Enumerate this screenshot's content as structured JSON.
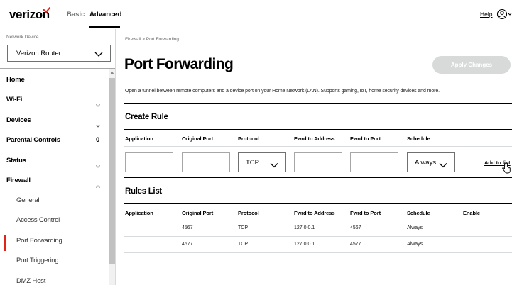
{
  "header": {
    "logo_text": "verizon",
    "tabs": [
      {
        "label": "Basic"
      },
      {
        "label": "Advanced"
      }
    ],
    "help_label": "Help",
    "accent_color": "#e2231a"
  },
  "sidebar": {
    "network_device_label": "Network Device",
    "network_device_value": "Verizon Router",
    "items": [
      {
        "label": "Home"
      },
      {
        "label": "Wi-Fi"
      },
      {
        "label": "Devices"
      },
      {
        "label": "Parental Controls",
        "count": "0"
      },
      {
        "label": "Status"
      },
      {
        "label": "Firewall"
      }
    ],
    "firewall_subitems": [
      {
        "label": "General"
      },
      {
        "label": "Access Control"
      },
      {
        "label": "Port Forwarding"
      },
      {
        "label": "Port Triggering"
      },
      {
        "label": "DMZ Host"
      }
    ]
  },
  "main": {
    "breadcrumb": "Firewall > Port Forwarding",
    "title": "Port Forwarding",
    "apply_label": "Apply Changes",
    "description": "Open a tunnel between remote computers and a device port on your Home Network (LAN). Supports gaming, IoT, home security devices and more.",
    "create_rule": {
      "title": "Create Rule",
      "columns": [
        "Application",
        "Original Port",
        "Protocol",
        "Fwrd to Address",
        "Fwrd to Port",
        "Schedule"
      ],
      "protocol_value": "TCP",
      "schedule_value": "Always",
      "add_label": "Add to list"
    },
    "rules_list": {
      "title": "Rules List",
      "columns": [
        "Application",
        "Original Port",
        "Protocol",
        "Fwrd to Address",
        "Fwrd to Port",
        "Schedule",
        "Enable"
      ],
      "rows": [
        [
          "",
          "4567",
          "TCP",
          "127.0.0.1",
          "4567",
          "Always"
        ],
        [
          "",
          "4577",
          "TCP",
          "127.0.0.1",
          "4577",
          "Always"
        ]
      ]
    }
  }
}
